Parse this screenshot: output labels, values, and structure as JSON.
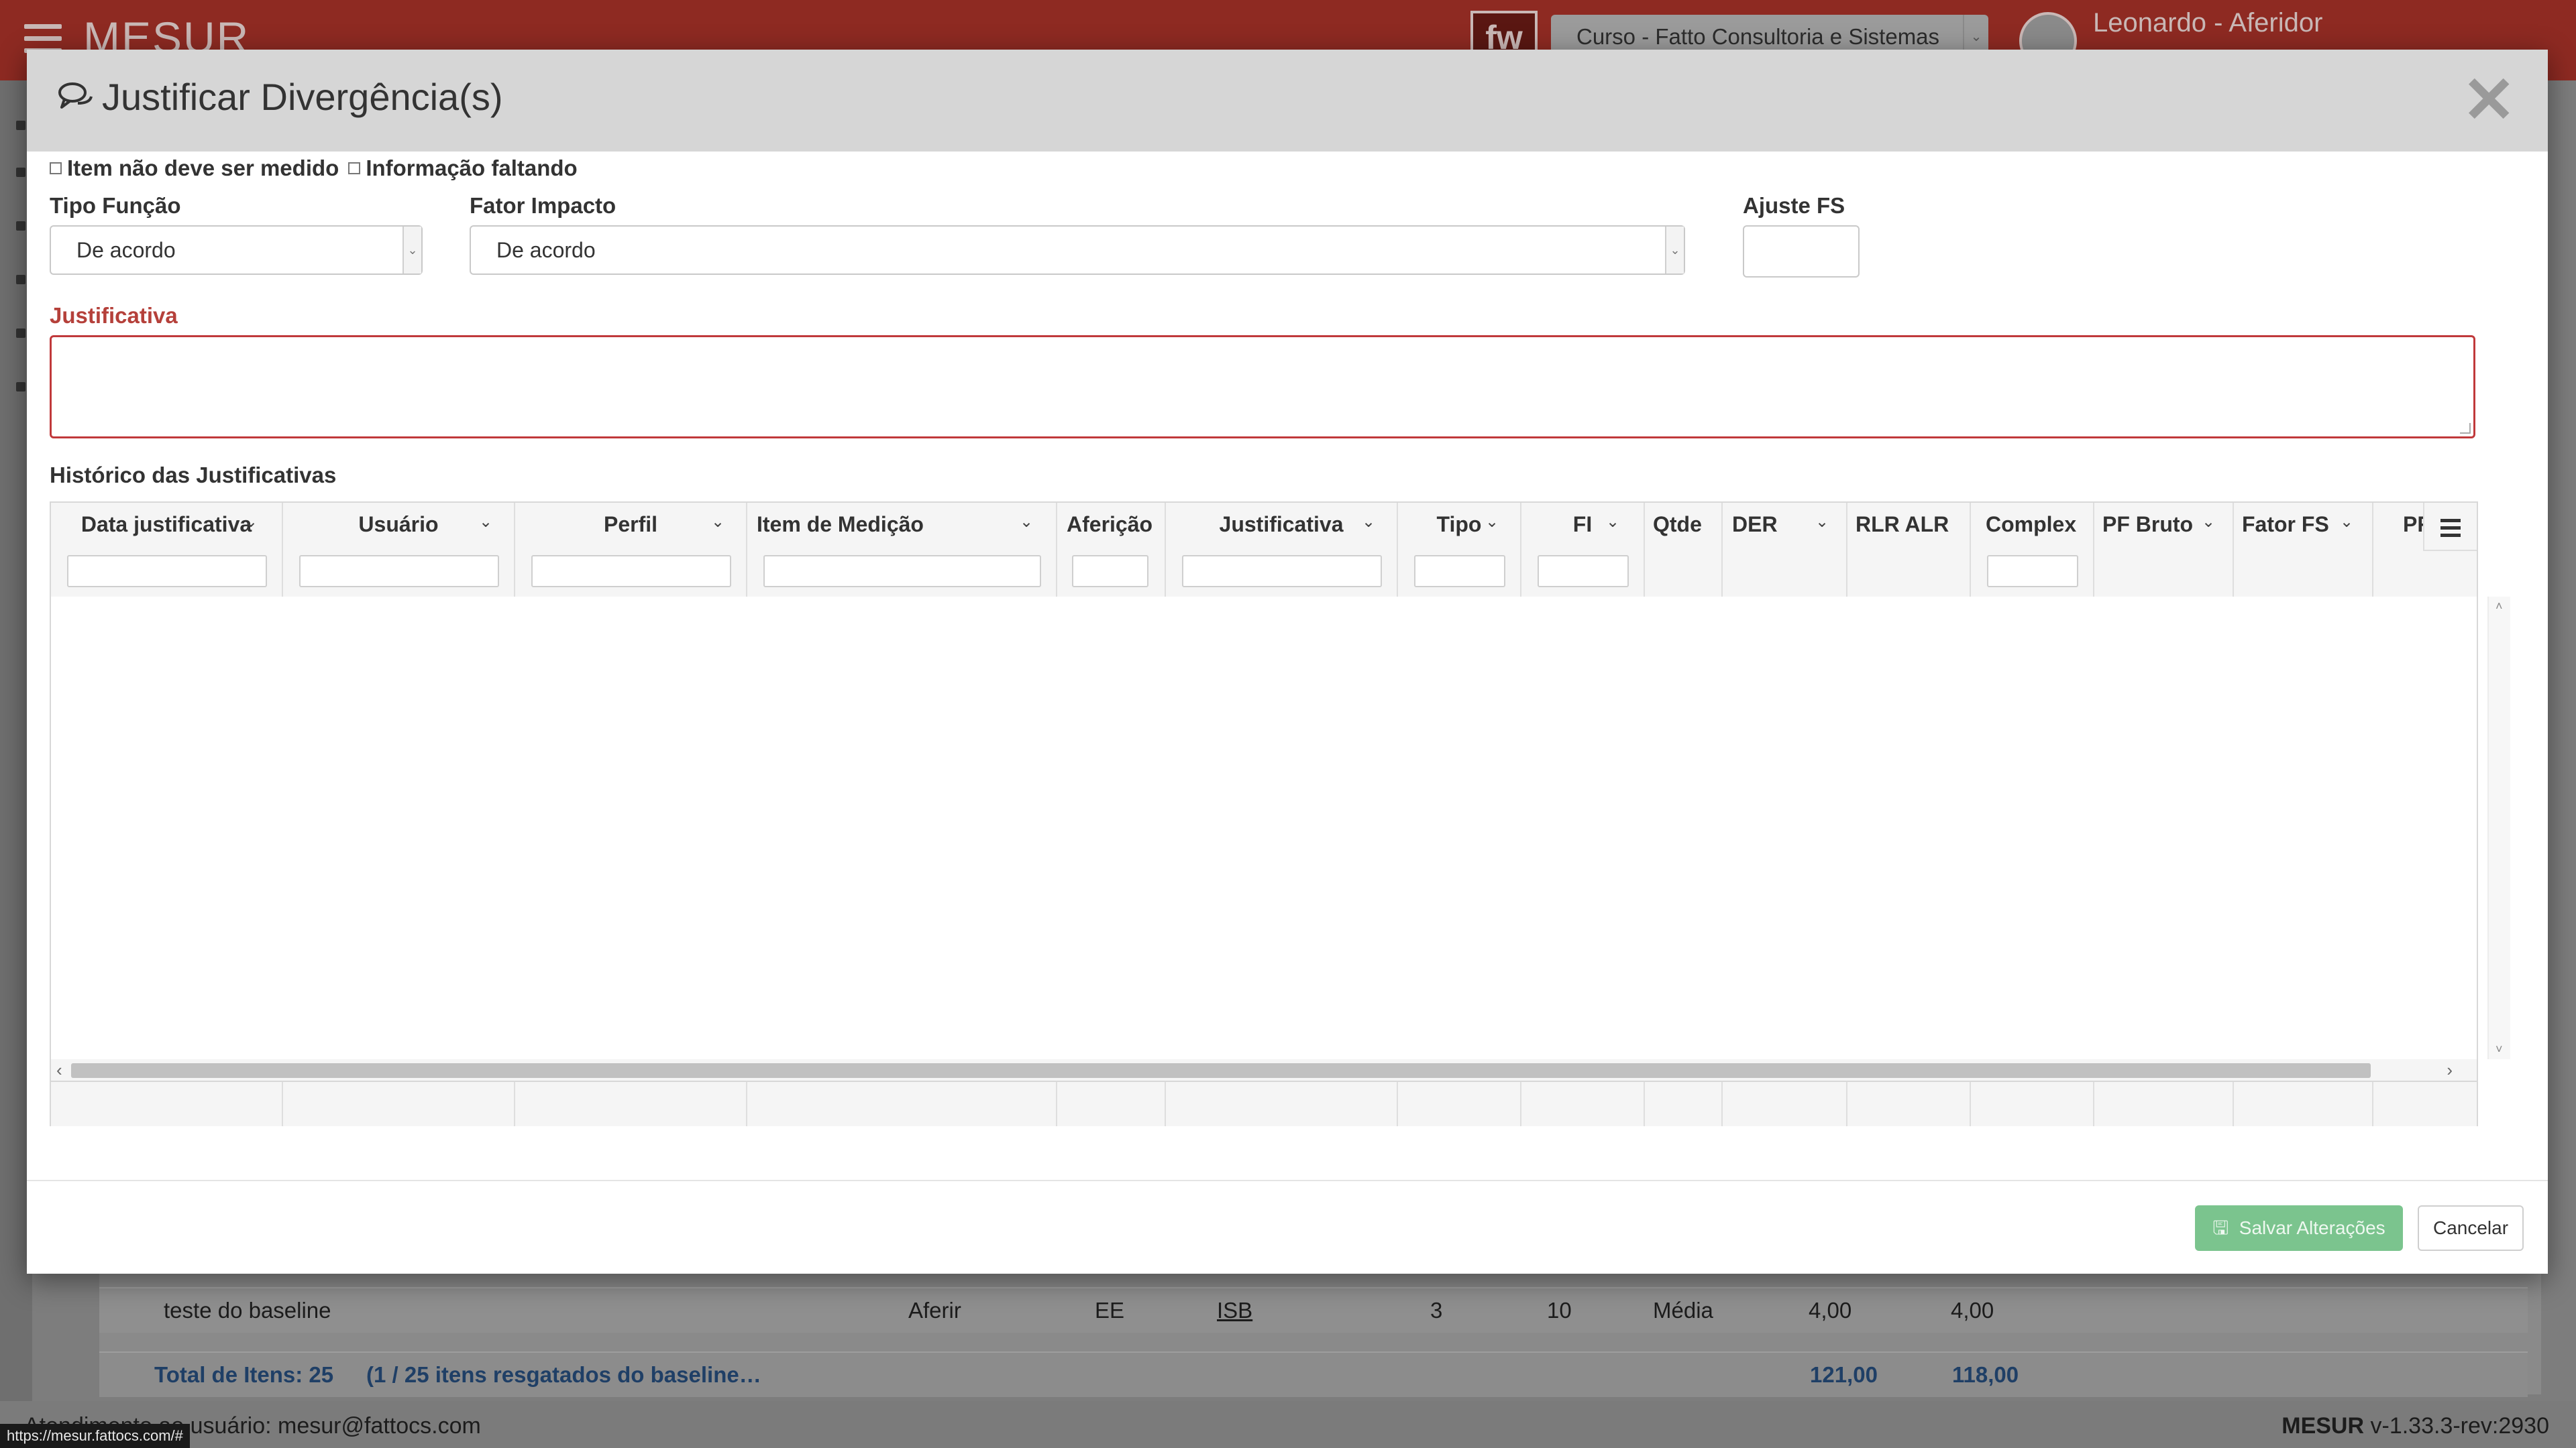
{
  "app": {
    "brand": "MESUR",
    "logo_text": "fw",
    "course_select": "Curso - Fatto Consultoria e Sistemas",
    "user_name": "Leonardo - Aferidor"
  },
  "background_table": {
    "row": {
      "name": "teste do baseline",
      "action": "Aferir",
      "tipo": "EE",
      "fi": "ISB",
      "qtde": "3",
      "der": "10",
      "complex": "Média",
      "pf_bruto": "4,00",
      "pf": "4,00"
    },
    "total_label": "Total de Itens: 25",
    "total_note": "(1 / 25 itens resgatados do baseline…",
    "total_pf_bruto": "121,00",
    "total_pf": "118,00"
  },
  "footer": {
    "support": "Atendimento ao usuário: mesur@fattocs.com",
    "version_brand": "MESUR",
    "version": "v-1.33.3-rev:2930"
  },
  "status_url": "https://mesur.fattocs.com/#",
  "modal": {
    "title": "Justificar Divergência(s)",
    "close_symbol": "✕",
    "checkbox_not_measured": "Item não deve ser medido",
    "checkbox_missing_info": "Informação faltando",
    "tipo_funcao_label": "Tipo Função",
    "tipo_funcao_value": "De acordo",
    "fator_impacto_label": "Fator Impacto",
    "fator_impacto_value": "De acordo",
    "ajuste_fs_label": "Ajuste FS",
    "justificativa_label": "Justificativa",
    "historico_label": "Histórico das Justificativas",
    "columns": [
      "Data justificativa",
      "Usuário",
      "Perfil",
      "Item de Medição",
      "Aferição",
      "Justificativa",
      "Tipo",
      "FI",
      "Qtde",
      "DER",
      "RLR ALR",
      "Complex",
      "PF Bruto",
      "Fator FS",
      "PF"
    ],
    "save_label": "Salvar Alterações",
    "cancel_label": "Cancelar"
  }
}
